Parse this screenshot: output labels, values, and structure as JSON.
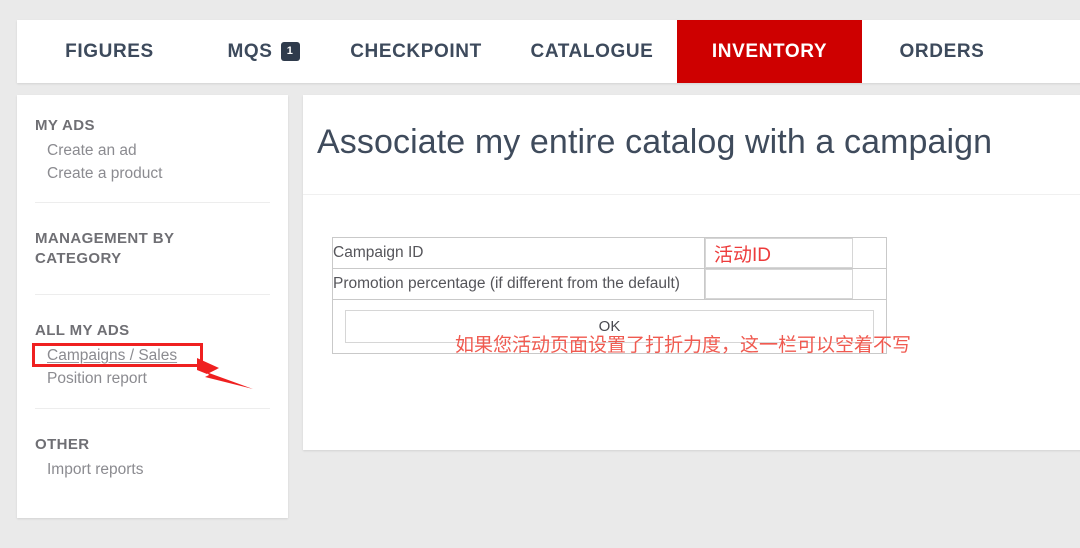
{
  "nav": {
    "tabs": [
      {
        "label": "FIGURES",
        "active": false,
        "badge": null
      },
      {
        "label": "MQS",
        "active": false,
        "badge": "1"
      },
      {
        "label": "CHECKPOINT",
        "active": false,
        "badge": null
      },
      {
        "label": "CATALOGUE",
        "active": false,
        "badge": null
      },
      {
        "label": "INVENTORY",
        "active": true,
        "badge": null
      },
      {
        "label": "ORDERS",
        "active": false,
        "badge": null
      }
    ],
    "active_tab": "INVENTORY",
    "active_color": "#ce0000",
    "badge_color": "#2f3b4c"
  },
  "sidebar": {
    "groups": [
      {
        "heading": "MY ADS",
        "links": [
          {
            "label": "Create an ad"
          },
          {
            "label": "Create a product"
          }
        ]
      },
      {
        "heading": "MANAGEMENT BY CATEGORY",
        "links": []
      },
      {
        "heading": "ALL MY ADS",
        "links": [
          {
            "label": "Campaigns / Sales",
            "highlighted": true
          },
          {
            "label": "Position report"
          }
        ]
      },
      {
        "heading": "OTHER",
        "links": [
          {
            "label": "Import reports"
          }
        ]
      }
    ]
  },
  "main": {
    "title": "Associate my entire catalog with a campaign",
    "form": {
      "rows": [
        {
          "label": "Campaign ID",
          "field_value": "活动ID",
          "field_placeholder": ""
        },
        {
          "label": "Promotion percentage (if different from the default)",
          "field_value": "",
          "field_placeholder": ""
        }
      ],
      "submit_label": "OK"
    }
  },
  "annotations": {
    "note_text": "如果您活动页面设置了打折力度，这一栏可以空着不写",
    "note_color": "#f05a50",
    "box_color": "#ef2020",
    "arrow_target": "Campaigns / Sales"
  }
}
